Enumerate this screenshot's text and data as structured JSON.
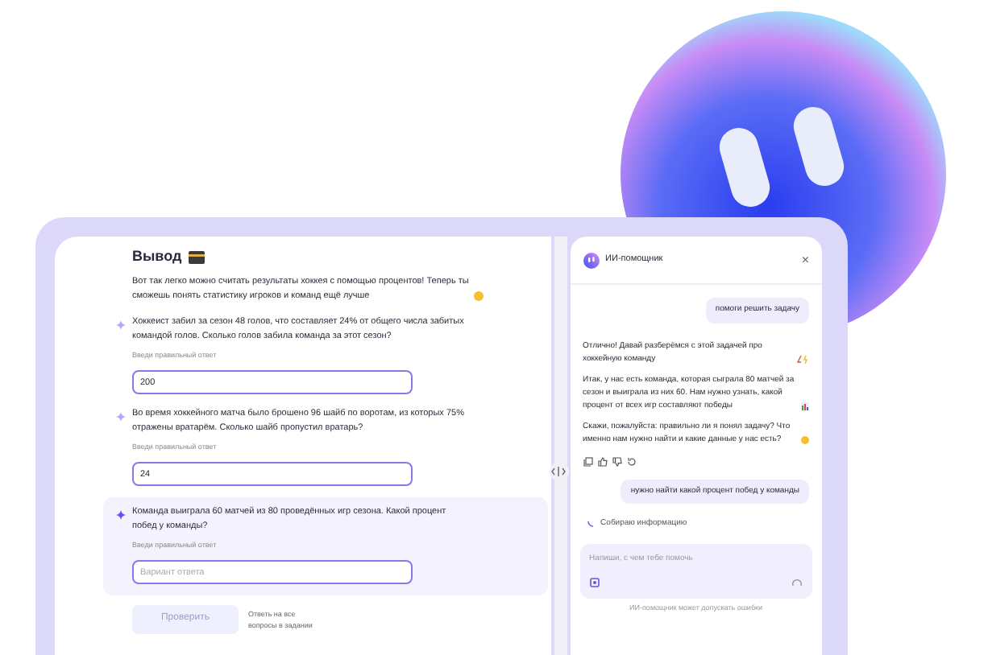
{
  "lesson": {
    "heading": "Вывод",
    "intro": "Вот так легко можно считать результаты хоккея с помощью процентов! Теперь ты сможешь понять статистику игроков и команд ещё лучше",
    "questions": [
      {
        "text": "Хоккеист забил за сезон 48 голов, что составляет 24% от общего числа забитых командой голов. Сколько голов забила команда за этот сезон?",
        "label": "Введи правильный ответ",
        "value": "200",
        "active": false
      },
      {
        "text": "Во время хоккейного матча было брошено 96 шайб по воротам, из которых 75% отражены вратарём. Сколько шайб пропустил вратарь?",
        "label": "Введи правильный ответ",
        "value": "24",
        "active": false
      },
      {
        "text": "Команда выиграла 60 матчей из 80 проведённых игр сезона. Какой процент побед у команды?",
        "label": "Введи правильный ответ",
        "placeholder": "Вариант ответа",
        "active": true
      }
    ],
    "check_button": {
      "label": "Проверить",
      "disabled": true
    },
    "hint": "Ответь на все вопросы в задании"
  },
  "assistant": {
    "title": "ИИ-помощник",
    "close": "×",
    "messages": [
      {
        "kind": "user",
        "text": "помоги решить задачу"
      },
      {
        "kind": "bot",
        "paragraphs": [
          "Отлично! Давай разберёмся с этой задачей про хоккейную команду",
          "Итак, у нас есть команда, которая сыграла 80 матчей за сезон и выиграла из них 60. Нам нужно узнать, какой процент от всех игр составляют победы",
          "Скажи, пожалуйста: правильно ли я понял задачу? Что именно нам нужно найти и какие данные у нас есть?"
        ]
      },
      {
        "kind": "user",
        "text": "нужно найти какой процент побед у команды"
      }
    ],
    "status": "Собираю информацию",
    "input": {
      "placeholder": "Напиши, с чем тебе помочь"
    },
    "disclaimer": "ИИ-помощник может допускать ошибки"
  }
}
